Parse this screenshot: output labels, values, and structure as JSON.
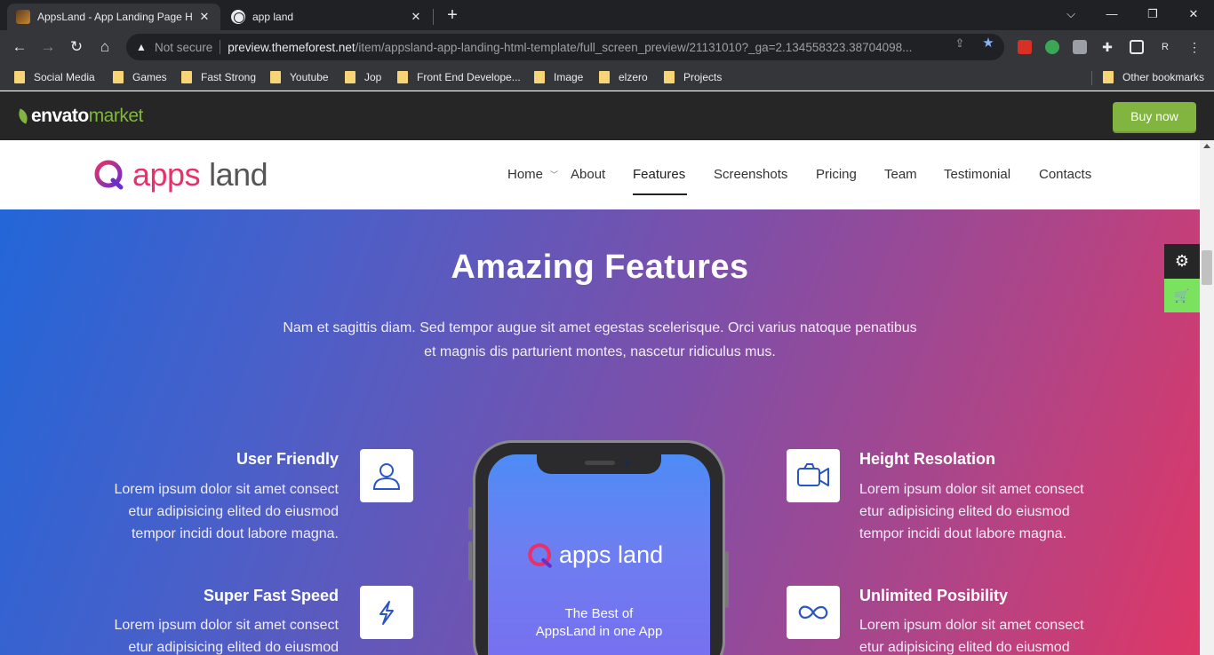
{
  "browser": {
    "tabs": [
      {
        "title": "AppsLand - App Landing Page H",
        "active": true
      },
      {
        "title": "app land",
        "active": false
      }
    ],
    "new_tab": "+",
    "window_controls": [
      "⌵",
      "—",
      "❐",
      "✕"
    ],
    "omnibox": {
      "security": "Not secure",
      "url_host": "preview.themeforest.net",
      "url_path": "/item/appsland-app-landing-html-template/full_screen_preview/21131010?_ga=2.134558323.38704098..."
    },
    "profile_initial": "R",
    "bookmarks": [
      "Social Media",
      "Games",
      "Fast Strong",
      "Youtube",
      "Jop",
      "Front End Develope...",
      "Image",
      "elzero",
      "Projects"
    ],
    "other_bookmarks": "Other bookmarks"
  },
  "envato": {
    "logo_word1": "envato",
    "logo_word2": "market",
    "buy_now": "Buy now",
    "brand_color": "#82b440"
  },
  "site": {
    "logo_apps": "apps",
    "logo_land": "land",
    "nav": [
      "Home",
      "About",
      "Features",
      "Screenshots",
      "Pricing",
      "Team",
      "Testimonial",
      "Contacts"
    ],
    "active_nav": "Features",
    "accent_color": "#e8306b"
  },
  "hero": {
    "title": "Amazing Features",
    "desc_line1": "Nam et sagittis diam. Sed tempor augue sit amet egestas scelerisque. Orci varius natoque penatibus",
    "desc_line2": "et magnis dis parturient montes, nascetur ridiculus mus.",
    "features": [
      {
        "title": "User Friendly",
        "line1": "Lorem ipsum dolor sit amet consect",
        "line2": "etur adipisicing elited do eiusmod",
        "line3": "tempor incidi dout labore magna.",
        "icon": "user-icon"
      },
      {
        "title": "Super Fast Speed",
        "line1": "Lorem ipsum dolor sit amet consect",
        "line2": "etur adipisicing elited do eiusmod",
        "icon": "lightning-icon"
      },
      {
        "title": "Height Resolation",
        "line1": "Lorem ipsum dolor sit amet consect",
        "line2": "etur adipisicing elited do eiusmod",
        "line3": "tempor incidi dout labore magna.",
        "icon": "video-camera-icon"
      },
      {
        "title": "Unlimited Posibility",
        "line1": "Lorem ipsum dolor sit amet consect",
        "line2": "etur adipisicing elited do eiusmod",
        "icon": "infinity-icon"
      }
    ],
    "phone": {
      "logo_text": "apps land",
      "tagline1": "The Best of",
      "tagline2": "AppsLand in one App"
    }
  },
  "side_widgets": {
    "gear": "gear-icon",
    "cart": "cart-icon"
  }
}
